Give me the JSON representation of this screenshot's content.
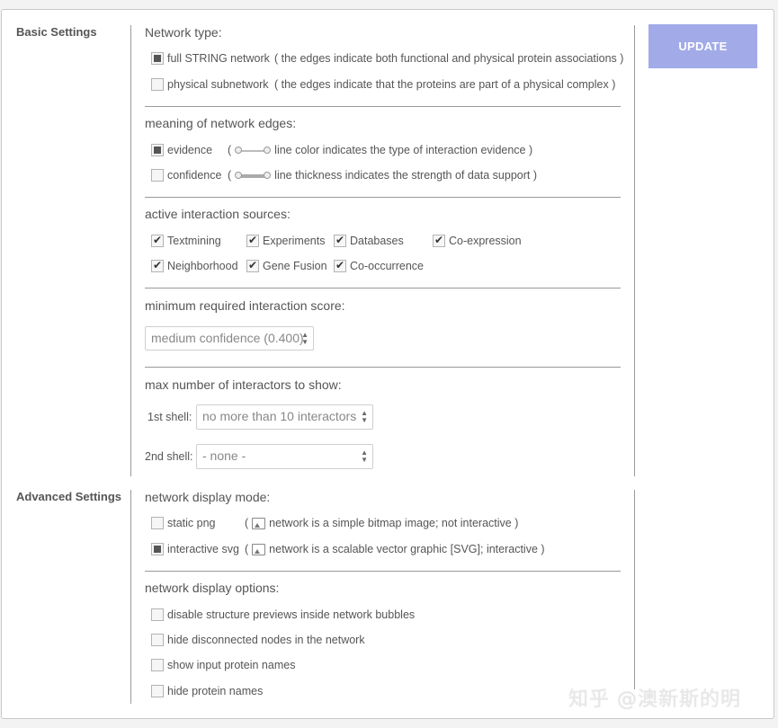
{
  "basic": {
    "title": "Basic Settings",
    "update_label": "UPDATE",
    "network_type": {
      "heading": "Network type:",
      "full_label": "full STRING network",
      "full_desc": "( the edges indicate both functional and physical protein associations )",
      "physical_label": "physical subnetwork",
      "physical_desc": "( the edges indicate that the proteins are part of a physical complex )"
    },
    "edges": {
      "heading": "meaning of network edges:",
      "evidence_label": "evidence",
      "evidence_desc_open": "(",
      "evidence_desc": "line color indicates the type of interaction evidence )",
      "confidence_label": "confidence",
      "confidence_desc_open": "(",
      "confidence_desc": "line thickness indicates the strength of data support )"
    },
    "sources": {
      "heading": "active interaction sources:",
      "textmining": "Textmining",
      "experiments": "Experiments",
      "databases": "Databases",
      "coexpression": "Co-expression",
      "neighborhood": "Neighborhood",
      "gene_fusion": "Gene Fusion",
      "cooccurrence": "Co-occurrence"
    },
    "score": {
      "heading": "minimum required interaction score:",
      "selected": "medium confidence (0.400)"
    },
    "interactors": {
      "heading": "max number of interactors to show:",
      "shell1_label": "1st shell:",
      "shell1_value": "no more than 10 interactors",
      "shell2_label": "2nd shell:",
      "shell2_value": "- none -"
    }
  },
  "advanced": {
    "title": "Advanced Settings",
    "display_mode": {
      "heading": "network display mode:",
      "static_label": "static png",
      "static_desc_open": "(",
      "static_desc": "network is a simple bitmap image; not interactive )",
      "svg_label": "interactive svg",
      "svg_desc_open": "(",
      "svg_desc": "network is a scalable vector graphic [SVG]; interactive )"
    },
    "display_options": {
      "heading": "network display options:",
      "opt1": "disable structure previews inside network bubbles",
      "opt2": "hide disconnected nodes in the network",
      "opt3": "show input protein names",
      "opt4": "hide protein names"
    }
  },
  "watermark": "知乎 @澳新斯的明"
}
